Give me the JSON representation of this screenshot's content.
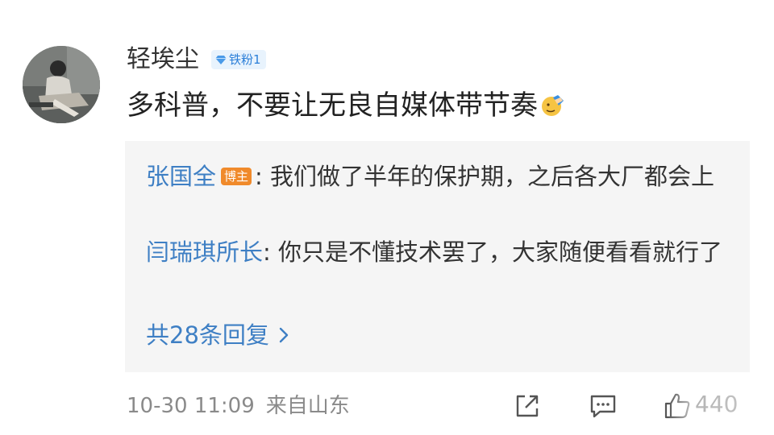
{
  "top_hint": "",
  "user": {
    "name": "轻埃尘",
    "fan_badge": "铁粉1",
    "avatar": "avatar-photo"
  },
  "comment": {
    "text": "多科普，不要让无良自媒体带节奏",
    "emoji": "facepalm-emoji"
  },
  "replies": [
    {
      "author": "张国全",
      "badge": "博主",
      "text": "我们做了半年的保护期，之后各大厂都会上"
    },
    {
      "author": "闫瑞琪所长",
      "badge": "",
      "text": "你只是不懂技术罢了，大家随便看看就行了"
    }
  ],
  "more_replies": "共28条回复",
  "footer": {
    "time": "10-30 11:09",
    "location": "来自山东",
    "like_count": "440"
  },
  "icons": {
    "share": "share-icon",
    "comment": "comment-icon",
    "like": "like-icon",
    "chevron": "chevron-right-icon"
  },
  "colors": {
    "link_blue": "#3e7fc4",
    "blogger_badge": "#f08a2b",
    "reply_bg": "#f5f5f5",
    "fan_badge_bg": "#e8f3fd"
  }
}
